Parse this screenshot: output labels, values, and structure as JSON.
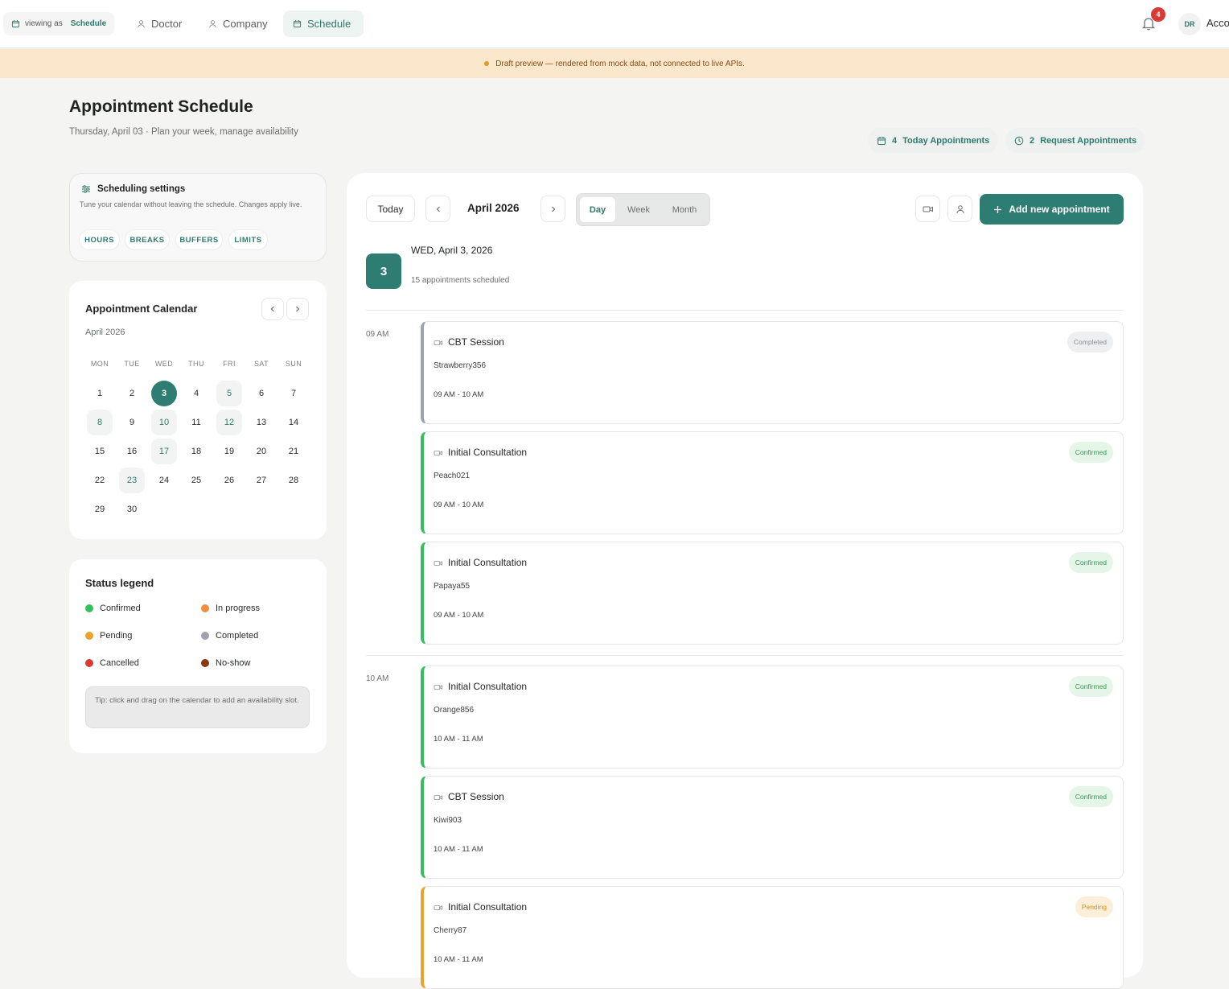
{
  "topbar": {
    "viewing_as_label": "viewing as",
    "viewing_as_value": "Schedule",
    "nav": [
      {
        "label": "Doctor",
        "icon": "person-icon"
      },
      {
        "label": "Company",
        "icon": "person-icon"
      },
      {
        "label": "Schedule",
        "icon": "calendar-icon",
        "active": true
      }
    ],
    "notification_count": "4",
    "avatar_initials": "DR",
    "account_label": "Acco"
  },
  "banner": {
    "text": "Draft preview — rendered from mock data, not connected to live APIs."
  },
  "header": {
    "title": "Appointment Schedule",
    "subtitle": "Thursday, April 03 · Plan your week, manage availability",
    "chips": [
      {
        "count": "4",
        "label": "Today Appointments",
        "icon": "calendar-icon"
      },
      {
        "count": "2",
        "label": "Request Appointments",
        "icon": "clock-icon"
      }
    ]
  },
  "settings": {
    "title": "Scheduling settings",
    "description": "Tune your calendar without leaving the schedule. Changes apply live.",
    "pills": [
      "HOURS",
      "BREAKS",
      "BUFFERS",
      "LIMITS"
    ]
  },
  "calendar": {
    "title": "Appointment Calendar",
    "month": "April 2026",
    "weekdays": [
      "MON",
      "TUE",
      "WED",
      "THU",
      "FRI",
      "SAT",
      "SUN"
    ],
    "days": [
      "1",
      "2",
      "3",
      "4",
      "5",
      "6",
      "7",
      "8",
      "9",
      "10",
      "11",
      "12",
      "13",
      "14",
      "15",
      "16",
      "17",
      "18",
      "19",
      "20",
      "21",
      "22",
      "23",
      "24",
      "25",
      "26",
      "27",
      "28",
      "29",
      "30"
    ],
    "selected_day": "3",
    "days_with_appointments": [
      "5",
      "8",
      "10",
      "12",
      "17",
      "23"
    ]
  },
  "legend": {
    "title": "Status legend",
    "items": [
      {
        "label": "Confirmed",
        "color": "#34c05a"
      },
      {
        "label": "In progress",
        "color": "#f0903e"
      },
      {
        "label": "Pending",
        "color": "#eba32b"
      },
      {
        "label": "Completed",
        "color": "#9ea3ad"
      },
      {
        "label": "Cancelled",
        "color": "#d93a36"
      },
      {
        "label": "No-show",
        "color": "#8a3a10"
      }
    ],
    "tip": "Tip: click and drag on the calendar to add an availability slot."
  },
  "toolbar": {
    "today_label": "Today",
    "month_label": "April 2026",
    "views": [
      "Day",
      "Week",
      "Month"
    ],
    "active_view": "Day",
    "add_label": "Add new appointment"
  },
  "day": {
    "number": "3",
    "title": "WED, April 3, 2026",
    "count_text": "15 appointments scheduled"
  },
  "schedule": [
    {
      "hour": "09 AM",
      "appointments": [
        {
          "title": "CBT Session",
          "patient": "Strawberry356",
          "time": "09 AM - 10 AM",
          "status": "Completed",
          "color": "#9ea3ad"
        },
        {
          "title": "Initial Consultation",
          "patient": "Peach021",
          "time": "09 AM - 10 AM",
          "status": "Confirmed",
          "color": "#34c05a"
        },
        {
          "title": "Initial Consultation",
          "patient": "Papaya55",
          "time": "09 AM - 10 AM",
          "status": "Confirmed",
          "color": "#34c05a"
        }
      ]
    },
    {
      "hour": "10 AM",
      "appointments": [
        {
          "title": "Initial Consultation",
          "patient": "Orange856",
          "time": "10 AM - 11 AM",
          "status": "Confirmed",
          "color": "#34c05a"
        },
        {
          "title": "CBT Session",
          "patient": "Kiwi903",
          "time": "10 AM - 11 AM",
          "status": "Confirmed",
          "color": "#34c05a"
        },
        {
          "title": "Initial Consultation",
          "patient": "Cherry87",
          "time": "10 AM - 11 AM",
          "status": "Pending",
          "color": "#eba32b"
        }
      ]
    }
  ]
}
